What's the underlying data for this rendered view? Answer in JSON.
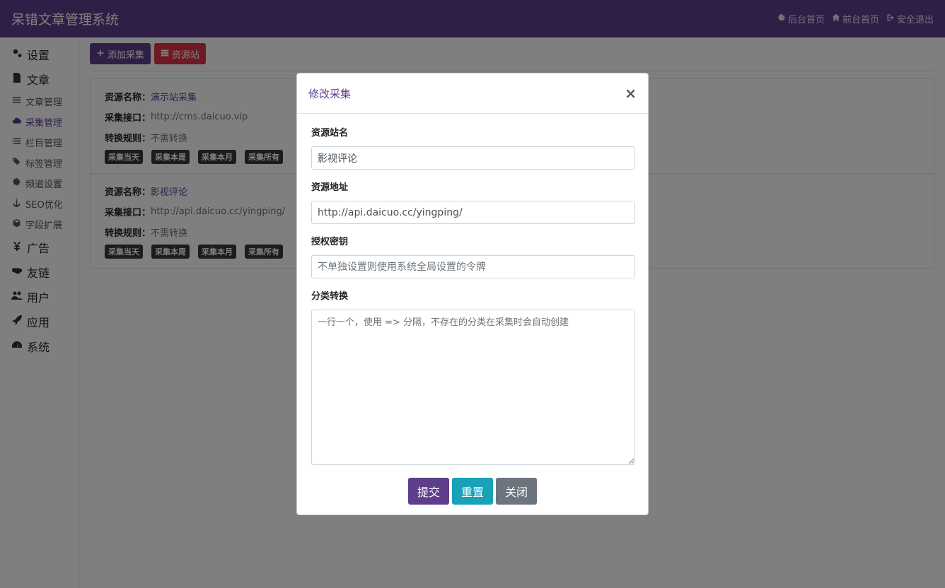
{
  "app": {
    "title": "呆错文章管理系统"
  },
  "top_links": [
    {
      "label": "后台首页",
      "icon": "gear-icon"
    },
    {
      "label": "前台首页",
      "icon": "home-icon"
    },
    {
      "label": "安全退出",
      "icon": "sign-out-icon"
    }
  ],
  "sidebar": {
    "items": [
      {
        "label": "设置",
        "icon": "gears-icon"
      },
      {
        "label": "文章",
        "icon": "file-icon"
      },
      {
        "label": "文章管理",
        "icon": "list-icon"
      },
      {
        "label": "采集管理",
        "icon": "cloud-icon"
      },
      {
        "label": "栏目管理",
        "icon": "list-alt-icon"
      },
      {
        "label": "标签管理",
        "icon": "tags-icon"
      },
      {
        "label": "频道设置",
        "icon": "cog-icon"
      },
      {
        "label": "SEO优化",
        "icon": "anchor-icon"
      },
      {
        "label": "字段扩展",
        "icon": "cube-icon"
      },
      {
        "label": "广告",
        "icon": "yen-icon"
      },
      {
        "label": "友链",
        "icon": "handshake-icon"
      },
      {
        "label": "用户",
        "icon": "users-icon"
      },
      {
        "label": "应用",
        "icon": "rocket-icon"
      },
      {
        "label": "系统",
        "icon": "dashboard-icon"
      }
    ]
  },
  "toolbar": {
    "add_label": "添加采集",
    "sources_label": "资源站"
  },
  "collections": [
    {
      "name_label": "资源名称：",
      "name": "演示站采集",
      "api_label": "采集接口：",
      "api": "http://cms.daicuo.vip",
      "rule_label": "转换规则：",
      "rule": "不需转换",
      "actions": [
        "采集当天",
        "采集本周",
        "采集本月",
        "采集所有"
      ]
    },
    {
      "name_label": "资源名称：",
      "name": "影视评论",
      "api_label": "采集接口：",
      "api": "http://api.daicuo.cc/yingping/",
      "rule_label": "转换规则：",
      "rule": "不需转换",
      "actions": [
        "采集当天",
        "采集本周",
        "采集本月",
        "采集所有"
      ]
    }
  ],
  "modal": {
    "title": "修改采集",
    "close": "×",
    "site_name_label": "资源站名",
    "site_name_value": "影视评论",
    "site_url_label": "资源地址",
    "site_url_value": "http://api.daicuo.cc/yingping/",
    "token_label": "授权密钥",
    "token_placeholder": "不单独设置则使用系统全局设置的令牌",
    "category_label": "分类转换",
    "category_placeholder": "一行一个，使用 => 分隔，不存在的分类在采集时会自动创建",
    "submit_label": "提交",
    "reset_label": "重置",
    "close_label": "关闭"
  },
  "colors": {
    "brand": "#5e3e8c",
    "danger": "#dc3545",
    "info": "#17a2b8",
    "secondary": "#6c757d",
    "badge_dark": "#343a40"
  }
}
